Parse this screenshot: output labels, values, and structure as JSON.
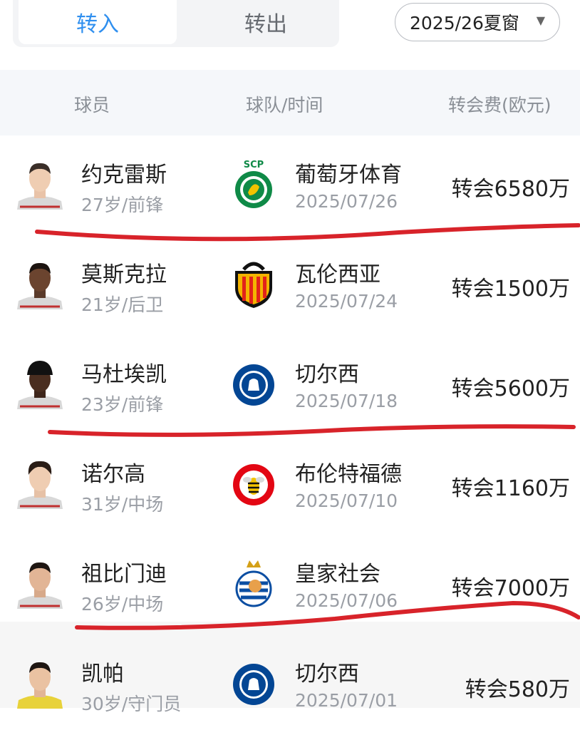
{
  "tabs": {
    "transfer_in": "转入",
    "transfer_out": "转出"
  },
  "season_selector": {
    "value": "2025/26夏窗",
    "icon": "chevron-down-icon"
  },
  "table_header": {
    "player": "球员",
    "team_time": "球队/时间",
    "fee": "转会费(欧元)"
  },
  "colors": {
    "accent": "#2f8fef",
    "pen": "#d8232a"
  },
  "rows": [
    {
      "name": "约克雷斯",
      "info": "27岁/前锋",
      "team": "葡萄牙体育",
      "date": "2025/07/26",
      "fee": "转会6580万",
      "crest": "sporting-cp-crest",
      "crest_text": "SCP"
    },
    {
      "name": "莫斯克拉",
      "info": "21岁/后卫",
      "team": "瓦伦西亚",
      "date": "2025/07/24",
      "fee": "转会1500万",
      "crest": "valencia-cf-crest",
      "crest_text": ""
    },
    {
      "name": "马杜埃凯",
      "info": "23岁/前锋",
      "team": "切尔西",
      "date": "2025/07/18",
      "fee": "转会5600万",
      "crest": "chelsea-fc-crest",
      "crest_text": ""
    },
    {
      "name": "诺尔高",
      "info": "31岁/中场",
      "team": "布伦特福德",
      "date": "2025/07/10",
      "fee": "转会1160万",
      "crest": "brentford-fc-crest",
      "crest_text": ""
    },
    {
      "name": "祖比门迪",
      "info": "26岁/中场",
      "team": "皇家社会",
      "date": "2025/07/06",
      "fee": "转会7000万",
      "crest": "real-sociedad-crest",
      "crest_text": ""
    },
    {
      "name": "凯帕",
      "info": "30岁/守门员",
      "team": "切尔西",
      "date": "2025/07/01",
      "fee": "转会580万",
      "crest": "chelsea-fc-crest",
      "crest_text": ""
    }
  ]
}
